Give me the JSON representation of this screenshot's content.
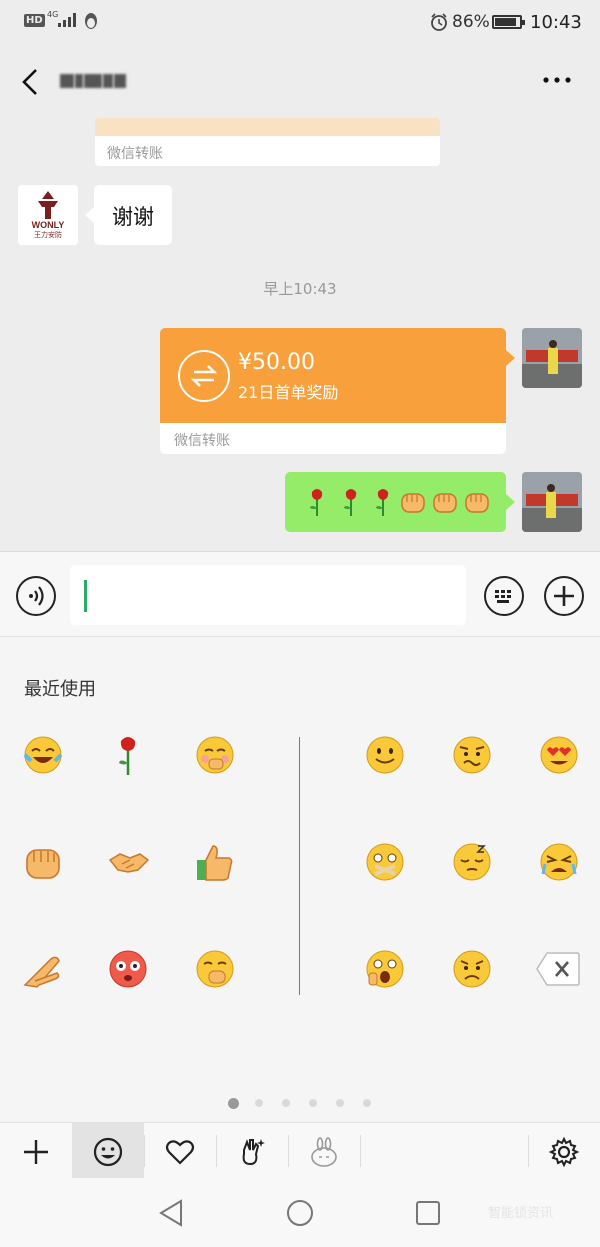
{
  "status_bar": {
    "hd": "HD",
    "network": "4G",
    "battery_percent": "86%",
    "battery_level": 0.86,
    "time": "10:43"
  },
  "header": {
    "back_icon": "back-arrow-icon",
    "contact_name": "",
    "more_icon": "more-dots-icon"
  },
  "chat": {
    "messages": [
      {
        "type": "transfer",
        "side": "left",
        "label": "微信转账",
        "partial": true
      },
      {
        "type": "text",
        "side": "left",
        "text": "谢谢",
        "avatar": "WONLY 王力安防"
      },
      {
        "type": "timestamp",
        "text": "早上10:43"
      },
      {
        "type": "transfer",
        "side": "right",
        "amount": "¥50.00",
        "note": "21日首单奖励",
        "label": "微信转账"
      },
      {
        "type": "emoji",
        "side": "right",
        "emojis": [
          "rose",
          "rose",
          "rose",
          "fist",
          "fist",
          "fist"
        ]
      }
    ],
    "left_avatar_brand": "WONLY",
    "left_avatar_subtitle": "王力安防",
    "colors": {
      "background": "#ededed",
      "transfer_orange": "#f8a03b",
      "green_bubble": "#95ec69"
    }
  },
  "input_bar": {
    "voice_icon": "voice-icon",
    "keyboard_icon": "keyboard-icon",
    "plus_icon": "plus-circle-icon",
    "value": ""
  },
  "emoji_panel": {
    "section_title": "最近使用",
    "recent": [
      "laugh-cry",
      "rose",
      "giggle",
      "fist",
      "handshake",
      "thumbs-up",
      "ok-hand",
      "angry-flushed",
      "smirk"
    ],
    "grid": [
      "smile",
      "awkward",
      "heart-eyes",
      "shut-mouth",
      "sleepy",
      "crying",
      "shocked",
      "sad",
      "backspace"
    ],
    "page_count": 6,
    "active_page": 1
  },
  "emoji_tabs": [
    {
      "icon": "plus-icon",
      "selected": false
    },
    {
      "icon": "smiley-icon",
      "selected": true
    },
    {
      "icon": "heart-icon",
      "selected": false
    },
    {
      "icon": "sparkle-hand-icon",
      "selected": false
    },
    {
      "icon": "bunny-icon",
      "selected": false
    },
    {
      "icon": "settings-gear-icon",
      "selected": false
    }
  ],
  "watermark": "智能锁资讯"
}
